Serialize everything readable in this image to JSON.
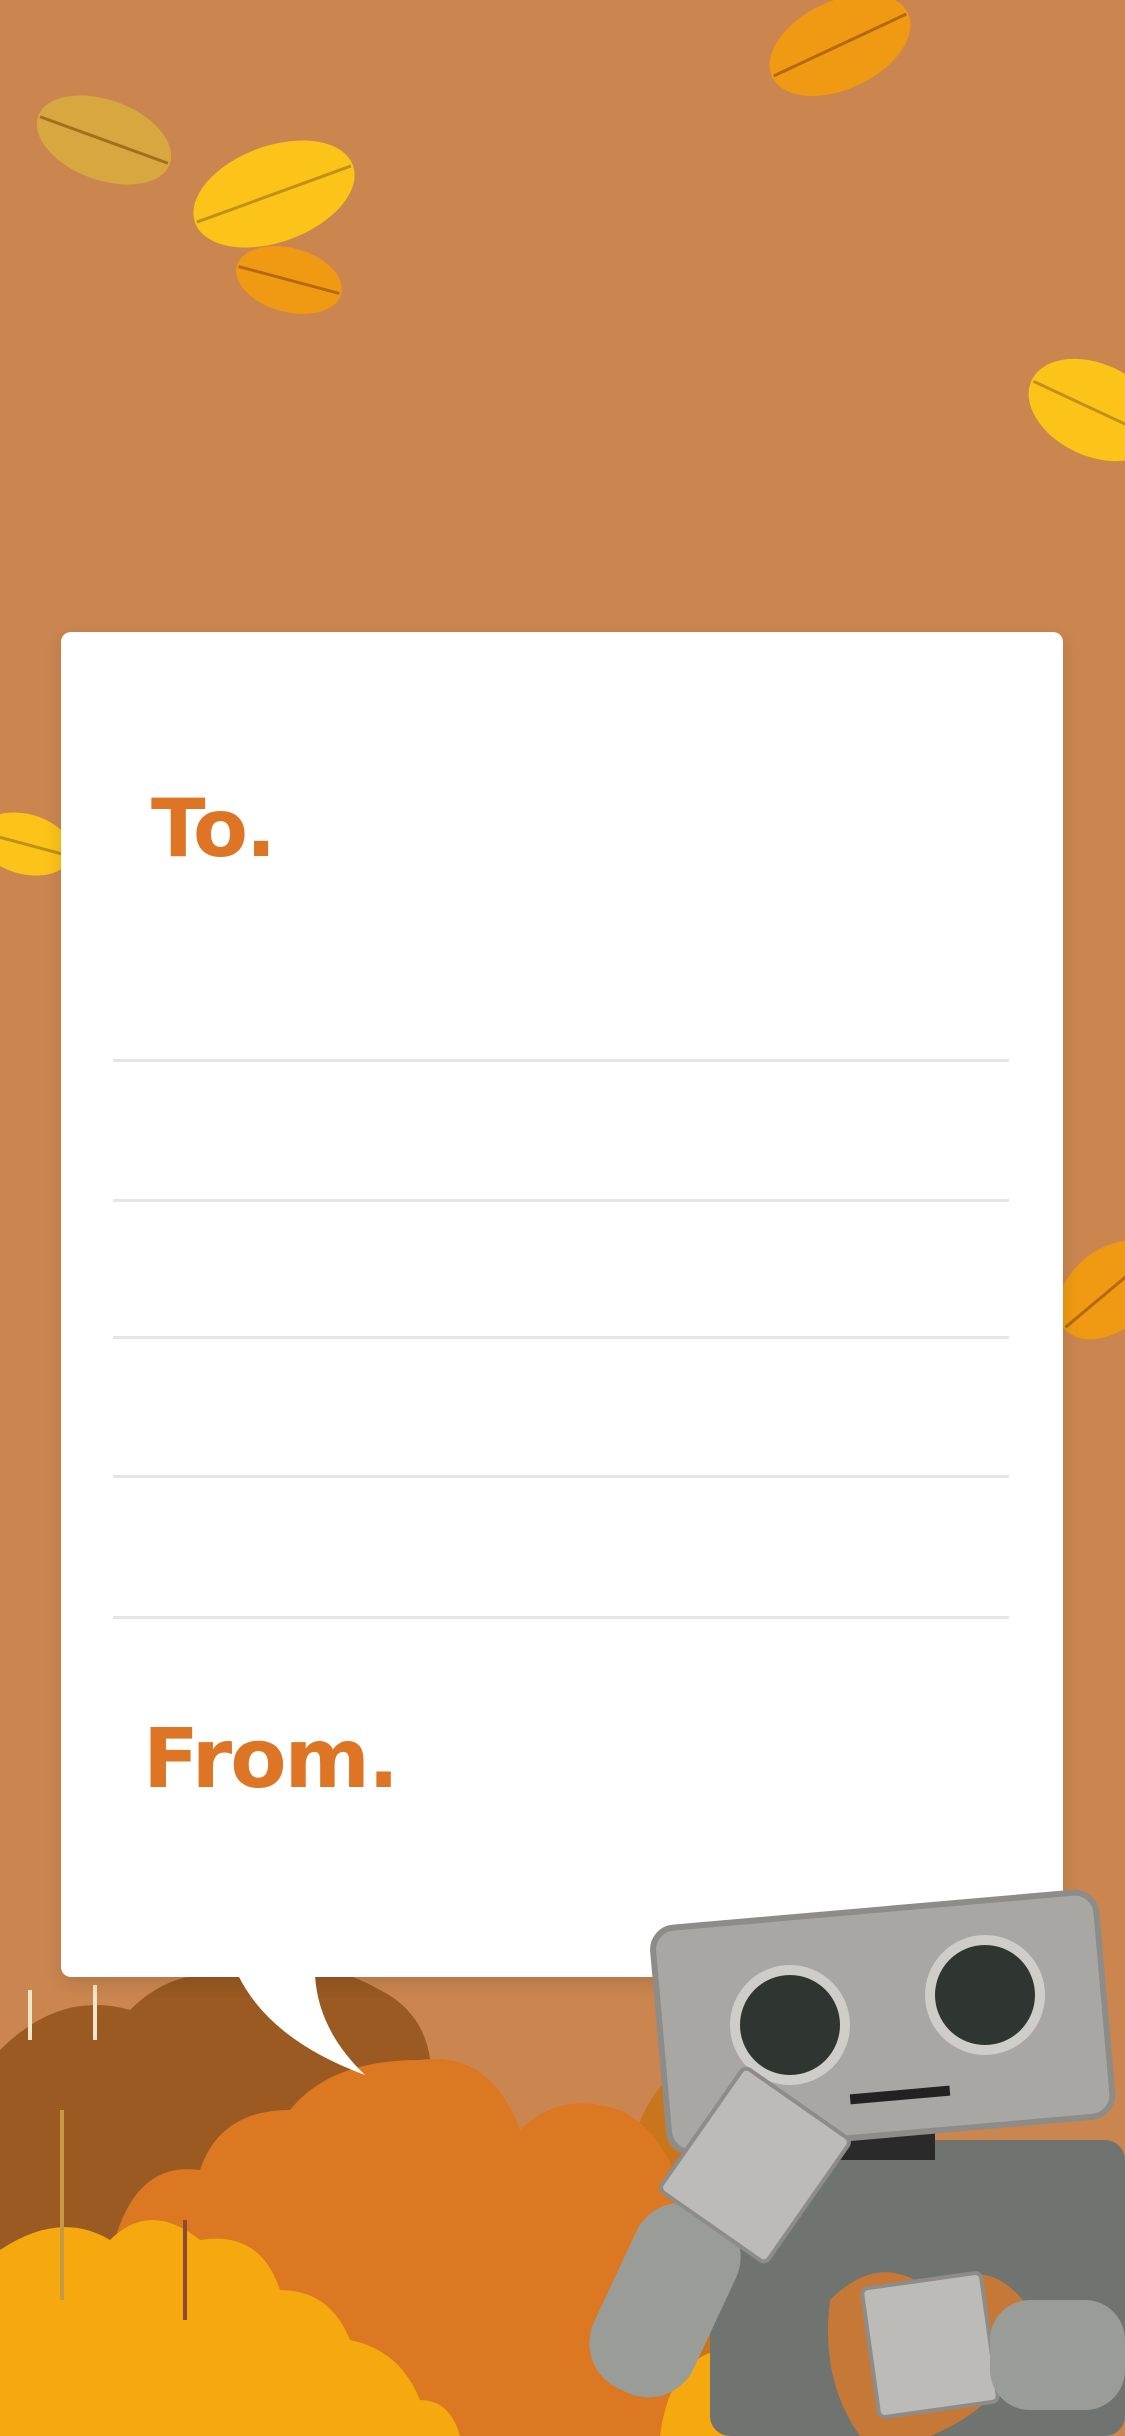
{
  "card": {
    "to_label": "To.",
    "from_label": "From.",
    "line_count": 5
  },
  "colors": {
    "background": "#cb8650",
    "accent_text": "#dd7524",
    "bush_dark": "#9a5a22",
    "bush_orange": "#dc7722",
    "bush_yellow": "#f5a90f",
    "leaf_yellow": "#fcc419",
    "leaf_orange": "#ef9a12"
  }
}
